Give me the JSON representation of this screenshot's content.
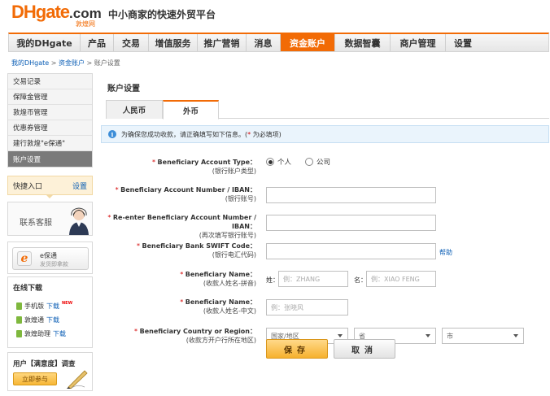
{
  "header": {
    "logo_main": "DHgate",
    "logo_suffix": ".com",
    "logo_cn": "敦煌网",
    "slogan": "中小商家的快速外贸平台"
  },
  "nav": {
    "items": [
      "我的DHgate",
      "产品",
      "交易",
      "增值服务",
      "推广营销",
      "消息",
      "资金账户",
      "数据智囊",
      "商户管理",
      "设置"
    ],
    "active": "资金账户"
  },
  "breadcrumb": {
    "items": [
      "我的DHgate",
      "资金账户",
      "账户设置"
    ],
    "sep": " > "
  },
  "sidebar": {
    "items": [
      "交易记录",
      "保障金管理",
      "敦煌币管理",
      "优惠券管理",
      "建行敦煌\"e保通\"",
      "账户设置"
    ],
    "active": "账户设置",
    "quick_entry": "快捷入口",
    "quick_settings": "设置",
    "customer_service": "联系客服",
    "epay_title": "e保通",
    "epay_sub": "发货即拿款",
    "download_title": "在线下载",
    "downloads": [
      {
        "label": "手机版",
        "link": "下载",
        "new": "NEW"
      },
      {
        "label": "敦煌通",
        "link": "下载"
      },
      {
        "label": "敦煌助理",
        "link": "下载"
      }
    ],
    "survey_title": "用户【满意度】调查",
    "survey_button": "立即参与"
  },
  "main": {
    "title": "账户设置",
    "tabs": [
      "人民币",
      "外币"
    ],
    "active_tab": "外币",
    "notice": "为确保您成功收款，请正确填写如下信息。(",
    "notice_star": "*",
    "notice_tail": "为必填项)",
    "fields": {
      "account_type": {
        "en": "Beneficiary Account Type：",
        "cn": "(银行账户类型)",
        "options": [
          "个人",
          "公司"
        ],
        "selected": "个人"
      },
      "account_number": {
        "en": "Beneficiary Account Number / IBAN：",
        "cn": "(银行账号)",
        "value": ""
      },
      "reenter_number": {
        "en": "Re-enter Beneficiary Account Number / IBAN：",
        "cn": "(再次填写银行账号)",
        "value": ""
      },
      "swift": {
        "en": "Beneficiary Bank SWIFT Code：",
        "cn": "(银行电汇代码)",
        "value": "",
        "help": "帮助"
      },
      "name_pinyin": {
        "en": "Beneficiary Name：",
        "cn": "(收款人姓名-拼音)",
        "last_label": "姓：",
        "last_placeholder": "例：ZHANG",
        "first_label": "名：",
        "first_placeholder": "例：XIAO FENG"
      },
      "name_chinese": {
        "en": "Beneficiary Name：",
        "cn": "(收款人姓名-中文)",
        "placeholder": "例：张晓风"
      },
      "country": {
        "en": "Beneficiary Country or Region：",
        "cn": "(收款方开户行所在地区)",
        "country_value": "国家/地区",
        "province_value": "省",
        "city_value": "市"
      }
    },
    "save_label": "保存",
    "cancel_label": "取消"
  },
  "colors": {
    "accent": "#f26b06",
    "link": "#0b5eb5",
    "required": "#d40000"
  }
}
